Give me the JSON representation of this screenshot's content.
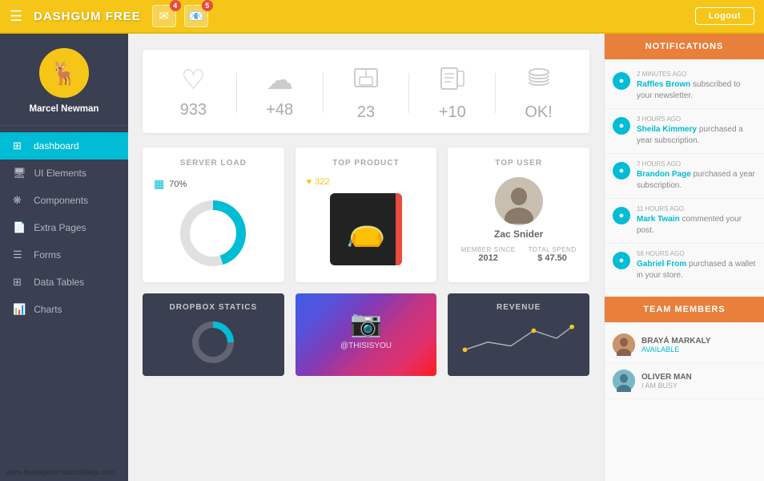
{
  "topnav": {
    "brand": "DASHGUM FREE",
    "hamburger_label": "☰",
    "msg_badge": "4",
    "mail_badge": "5",
    "logout_label": "Logout"
  },
  "sidebar": {
    "profile": {
      "name": "Marcel Newman"
    },
    "nav_items": [
      {
        "id": "dashboard",
        "label": "dashboard",
        "icon": "⊞",
        "active": true
      },
      {
        "id": "ui-elements",
        "label": "UI Elements",
        "icon": "🖥",
        "active": false
      },
      {
        "id": "components",
        "label": "Components",
        "icon": "❋",
        "active": false
      },
      {
        "id": "extra-pages",
        "label": "Extra Pages",
        "icon": "📄",
        "active": false
      },
      {
        "id": "forms",
        "label": "Forms",
        "icon": "☰",
        "active": false
      },
      {
        "id": "data-tables",
        "label": "Data Tables",
        "icon": "⊞",
        "active": false
      },
      {
        "id": "charts",
        "label": "Charts",
        "icon": "📊",
        "active": false
      }
    ]
  },
  "stats": [
    {
      "id": "likes",
      "icon": "♡",
      "value": "933"
    },
    {
      "id": "cloud",
      "icon": "☁",
      "value": "+48"
    },
    {
      "id": "inbox",
      "icon": "📥",
      "value": "23"
    },
    {
      "id": "news",
      "icon": "📰",
      "value": "+10"
    },
    {
      "id": "database",
      "icon": "🗄",
      "value": "OK!"
    }
  ],
  "server_load": {
    "title": "SERVER LOAD",
    "percent": "70%",
    "percent_num": 70
  },
  "top_product": {
    "title": "TOP PRODUCT",
    "likes": "322"
  },
  "top_user": {
    "title": "TOP USER",
    "name": "Zac Snider",
    "member_since_label": "MEMBER SINCE",
    "member_since": "2012",
    "total_spend_label": "TOTAL SPEND",
    "total_spend": "$ 47.50"
  },
  "dropbox": {
    "title": "DROPBOX STATICS"
  },
  "instagram": {
    "title": "@THISISYOU"
  },
  "revenue": {
    "title": "REVENUE"
  },
  "notifications": {
    "title": "NOTIFICATIONS",
    "items": [
      {
        "time": "2 MINUTES AGO",
        "link": "Raffles Brown",
        "text": " subscribed to your newsletter."
      },
      {
        "time": "3 HOURS AGO",
        "link": "Sheila Kimmery",
        "text": " purchased a year subscription."
      },
      {
        "time": "7 HOURS AGO",
        "link": "Brandon Page",
        "text": " purchased a year subscription."
      },
      {
        "time": "11 HOURS AGO",
        "link": "Mark Twain",
        "text": " commented your post."
      },
      {
        "time": "58 HOURS AGO",
        "link": "Gabriel From",
        "text": " purchased a wallet in your store."
      }
    ]
  },
  "team_members": {
    "title": "TEAM MEMBERS",
    "items": [
      {
        "name": "BRAYÁ MARKALY",
        "status": "AVAILABLE",
        "color": "#c8956a"
      },
      {
        "name": "OLIVER MAN",
        "status": "I AM BUSY",
        "color": "#7ab8c8"
      }
    ]
  },
  "watermark": "www.heritagechristiancollege.com"
}
